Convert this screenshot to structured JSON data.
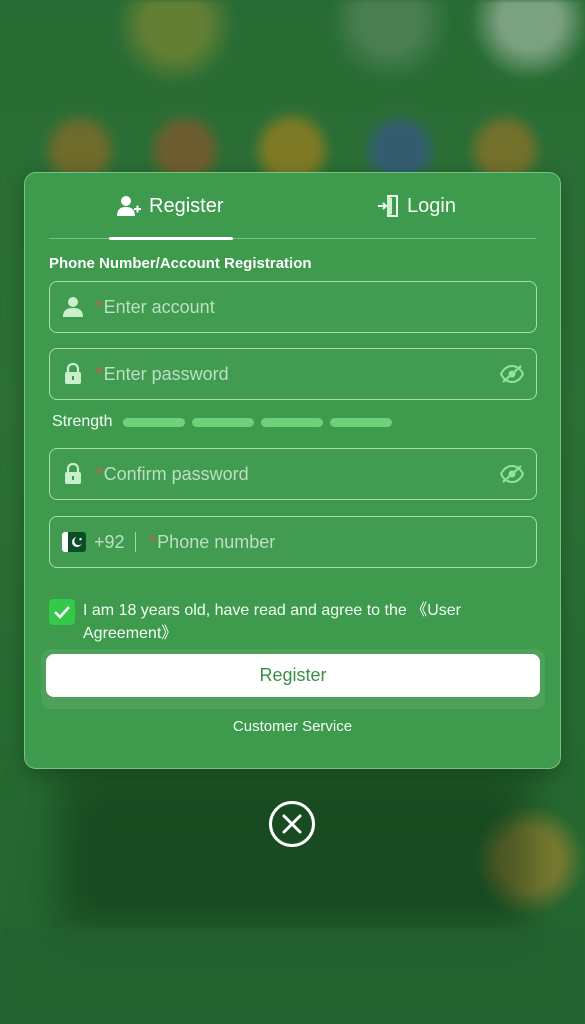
{
  "tabs": {
    "register_label": "Register",
    "login_label": "Login"
  },
  "form": {
    "section_title": "Phone Number/Account Registration",
    "required_mark": "*",
    "account_placeholder": "Enter account",
    "password_placeholder": "Enter password",
    "strength_label": "Strength",
    "confirm_placeholder": "Confirm password",
    "country_code": "+92",
    "phone_placeholder": "Phone number"
  },
  "agreement": {
    "text": "I am 18 years old, have read and agree to the ",
    "link": "《User Agreement》",
    "checked": true
  },
  "actions": {
    "register_button": "Register",
    "customer_service": "Customer Service"
  },
  "icons": {
    "account": "user-icon",
    "password": "lock-icon",
    "visibility": "eye-slash-icon",
    "flag": "pakistan-flag-icon",
    "close": "close-circle-icon"
  },
  "colors": {
    "accent": "#3e9a4d",
    "strength_bar": "#6fd27a",
    "checkbox": "#35c94a",
    "required": "#e0554a"
  }
}
